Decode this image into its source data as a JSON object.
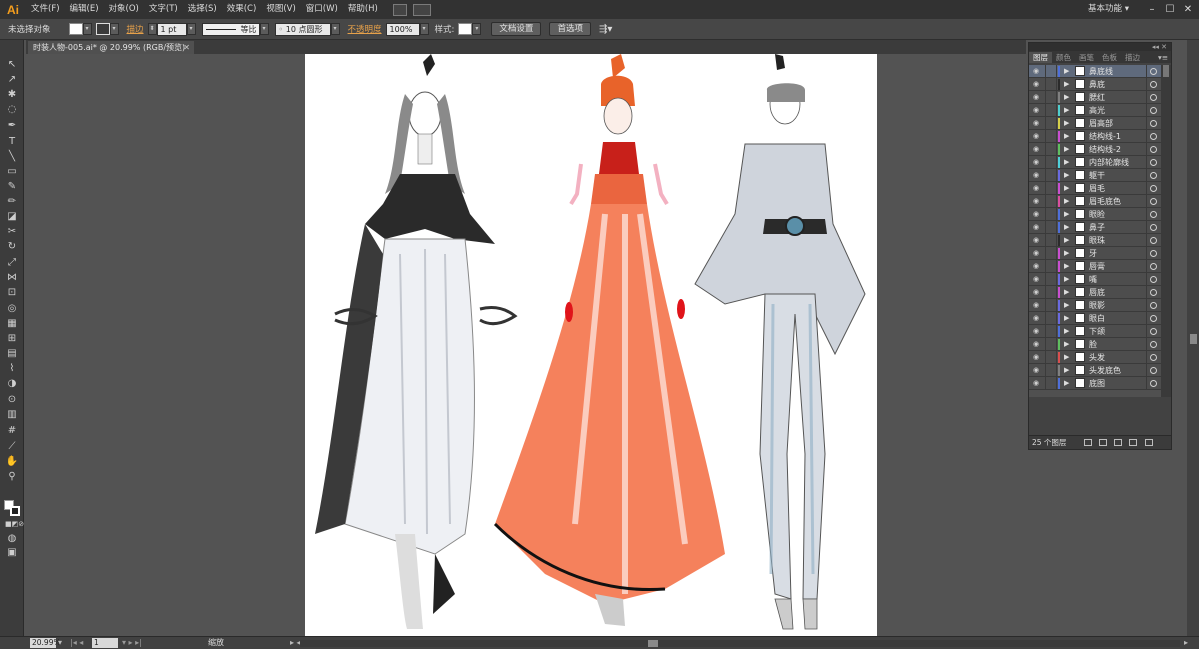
{
  "menubar": {
    "logo": "Ai",
    "items": [
      "文件(F)",
      "编辑(E)",
      "对象(O)",
      "文字(T)",
      "选择(S)",
      "效果(C)",
      "视图(V)",
      "窗口(W)",
      "帮助(H)"
    ],
    "workspace": "基本功能 ▾",
    "window_buttons": [
      "–",
      "☐",
      "✕"
    ]
  },
  "controlbar": {
    "no_selection": "未选择对象",
    "stroke_label": "描边",
    "stroke_value": "1 pt",
    "profile_label": "等比",
    "brush_label": "10 点圆形",
    "opacity_label": "不透明度",
    "opacity_value": "100%",
    "style_label": "样式:",
    "doc_setup": "文档设置",
    "preferences": "首选项"
  },
  "document": {
    "tab_title": "时装人物-005.ai* @ 20.99% (RGB/预览)",
    "close": "✕"
  },
  "layers_panel": {
    "tabs": [
      "图层",
      "颜色",
      "画笔",
      "色板",
      "描边"
    ],
    "active_tab": 0,
    "layers": [
      {
        "name": "鼻底线",
        "color": "#4f6fd9",
        "selected": true
      },
      {
        "name": "鼻底",
        "color": "#2b2b2b"
      },
      {
        "name": "腮红",
        "color": "#808080"
      },
      {
        "name": "高光",
        "color": "#4fcfcf"
      },
      {
        "name": "眉高部",
        "color": "#d6d04a"
      },
      {
        "name": "结构线-1",
        "color": "#c94fd0"
      },
      {
        "name": "结构线-2",
        "color": "#5fbf5f"
      },
      {
        "name": "内部轮廓线",
        "color": "#4fcfd9"
      },
      {
        "name": "躯干",
        "color": "#6a6adf"
      },
      {
        "name": "眉毛",
        "color": "#c94fd0"
      },
      {
        "name": "眉毛底色",
        "color": "#d94f9f"
      },
      {
        "name": "眼睑",
        "color": "#4f6fd9"
      },
      {
        "name": "鼻子",
        "color": "#4f6fd9"
      },
      {
        "name": "眼珠",
        "color": "#2b2b2b"
      },
      {
        "name": "牙",
        "color": "#c94fd0"
      },
      {
        "name": "唇膏",
        "color": "#c94fd0"
      },
      {
        "name": "嘴",
        "color": "#6a6adf"
      },
      {
        "name": "唇底",
        "color": "#c94fd0"
      },
      {
        "name": "眼影",
        "color": "#6a6adf"
      },
      {
        "name": "眼白",
        "color": "#6a6adf"
      },
      {
        "name": "下颌",
        "color": "#4f6fd9"
      },
      {
        "name": "脸",
        "color": "#5fbf5f"
      },
      {
        "name": "头发",
        "color": "#d94f4f"
      },
      {
        "name": "头发底色",
        "color": "#808080"
      },
      {
        "name": "底图",
        "color": "#4f6fd9"
      }
    ],
    "layer_count": "25 个图层"
  },
  "statusbar": {
    "zoom": "20.99%",
    "page": "1",
    "status_label": "缩放"
  },
  "colors": {
    "accent_orange": "#e7a14a",
    "panel_bg": "#424242",
    "ui_bg": "#535353"
  }
}
